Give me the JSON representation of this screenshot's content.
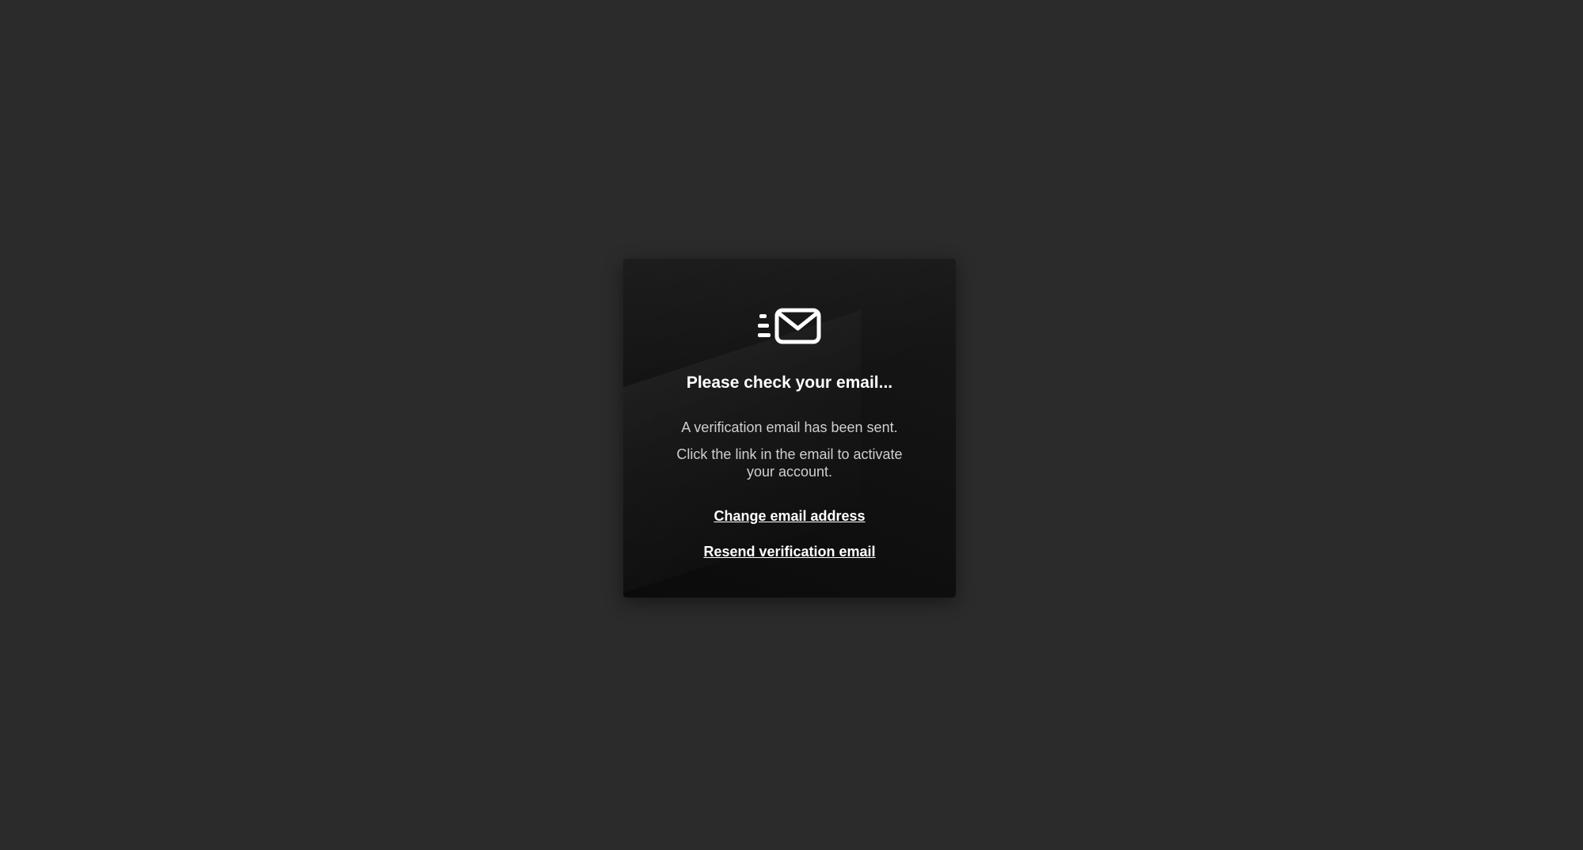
{
  "dialog": {
    "icon": "email-sent-icon",
    "title": "Please check your email...",
    "message_line1": "A verification email has been sent.",
    "message_line2": "Click the link in the email to activate your account.",
    "change_email_label": "Change email address",
    "resend_label": "Resend verification email"
  },
  "colors": {
    "page_background": "#2b2b2b",
    "card_background": "#121212",
    "title_text": "#ffffff",
    "body_text": "#cfcfcf"
  }
}
